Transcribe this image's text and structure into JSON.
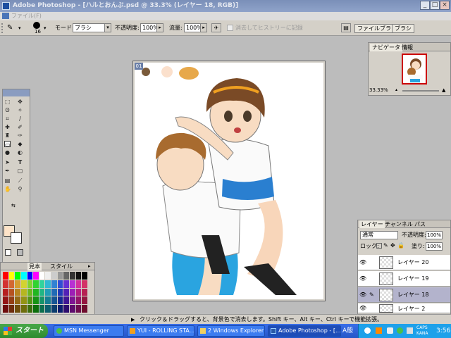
{
  "window": {
    "title": "Adobe Photoshop - [ハルとおんぶ.psd @ 33.3% (レイヤー 18, RGB)]",
    "controls": [
      "_",
      "□",
      "×"
    ]
  },
  "menubar": {
    "label": "ファイル(F)"
  },
  "options_bar": {
    "brush_size": "16",
    "mode_label": "モード:",
    "mode_value": "ブラシ",
    "opacity_label": "不透明度:",
    "opacity_value": "100%",
    "flow_label": "流量:",
    "flow_value": "100%",
    "erase_history_label": "消去してヒストリーに記録",
    "palette_well_tabs": [
      "ファイルブラウザ",
      "ブラシ"
    ]
  },
  "canvas": {
    "tab_label": "01"
  },
  "navigator": {
    "tabs": [
      "ナビゲータ",
      "情報"
    ],
    "zoom": "33.33%"
  },
  "layers_panel": {
    "tabs": [
      "レイヤー",
      "チャンネル",
      "パス"
    ],
    "blend_mode": "通常",
    "opacity_label": "不透明度:",
    "opacity_value": "100%",
    "lock_label": "ロック:",
    "fill_label": "塗り:",
    "fill_value": "100%",
    "layers": [
      {
        "name": "レイヤー 20",
        "selected": false
      },
      {
        "name": "レイヤー 19",
        "selected": false
      },
      {
        "name": "レイヤー 18",
        "selected": true
      },
      {
        "name": "レイヤー 2",
        "selected": false
      }
    ]
  },
  "swatches_panel": {
    "tabs": [
      "見本",
      "スタイル"
    ]
  },
  "colors": {
    "foreground": "#fde3c8",
    "background": "#ffffff",
    "canvas_swatches": [
      "#7a5a3a",
      "#fbe0cc",
      "#e7a84a"
    ]
  },
  "status_bar": {
    "text": "クリック＆ドラッグすると、背景色で消去します。Shift キー、Alt キー、Ctrl キーで機能拡張。"
  },
  "taskbar": {
    "start_label": "スタート",
    "tasks": [
      {
        "label": "MSN Messenger",
        "icon": "msn-icon",
        "active": false
      },
      {
        "label": "YUI - ROLLING STA...",
        "icon": "media-player-icon",
        "active": false
      },
      {
        "label": "2 Windows Explorer",
        "icon": "folder-icon",
        "active": false
      },
      {
        "label": "Adobe Photoshop - [...",
        "icon": "photoshop-icon",
        "active": true
      }
    ],
    "ime_label": "A般",
    "ime_caps": "CAPS",
    "ime_kana": "KANA",
    "clock": "3:56"
  }
}
